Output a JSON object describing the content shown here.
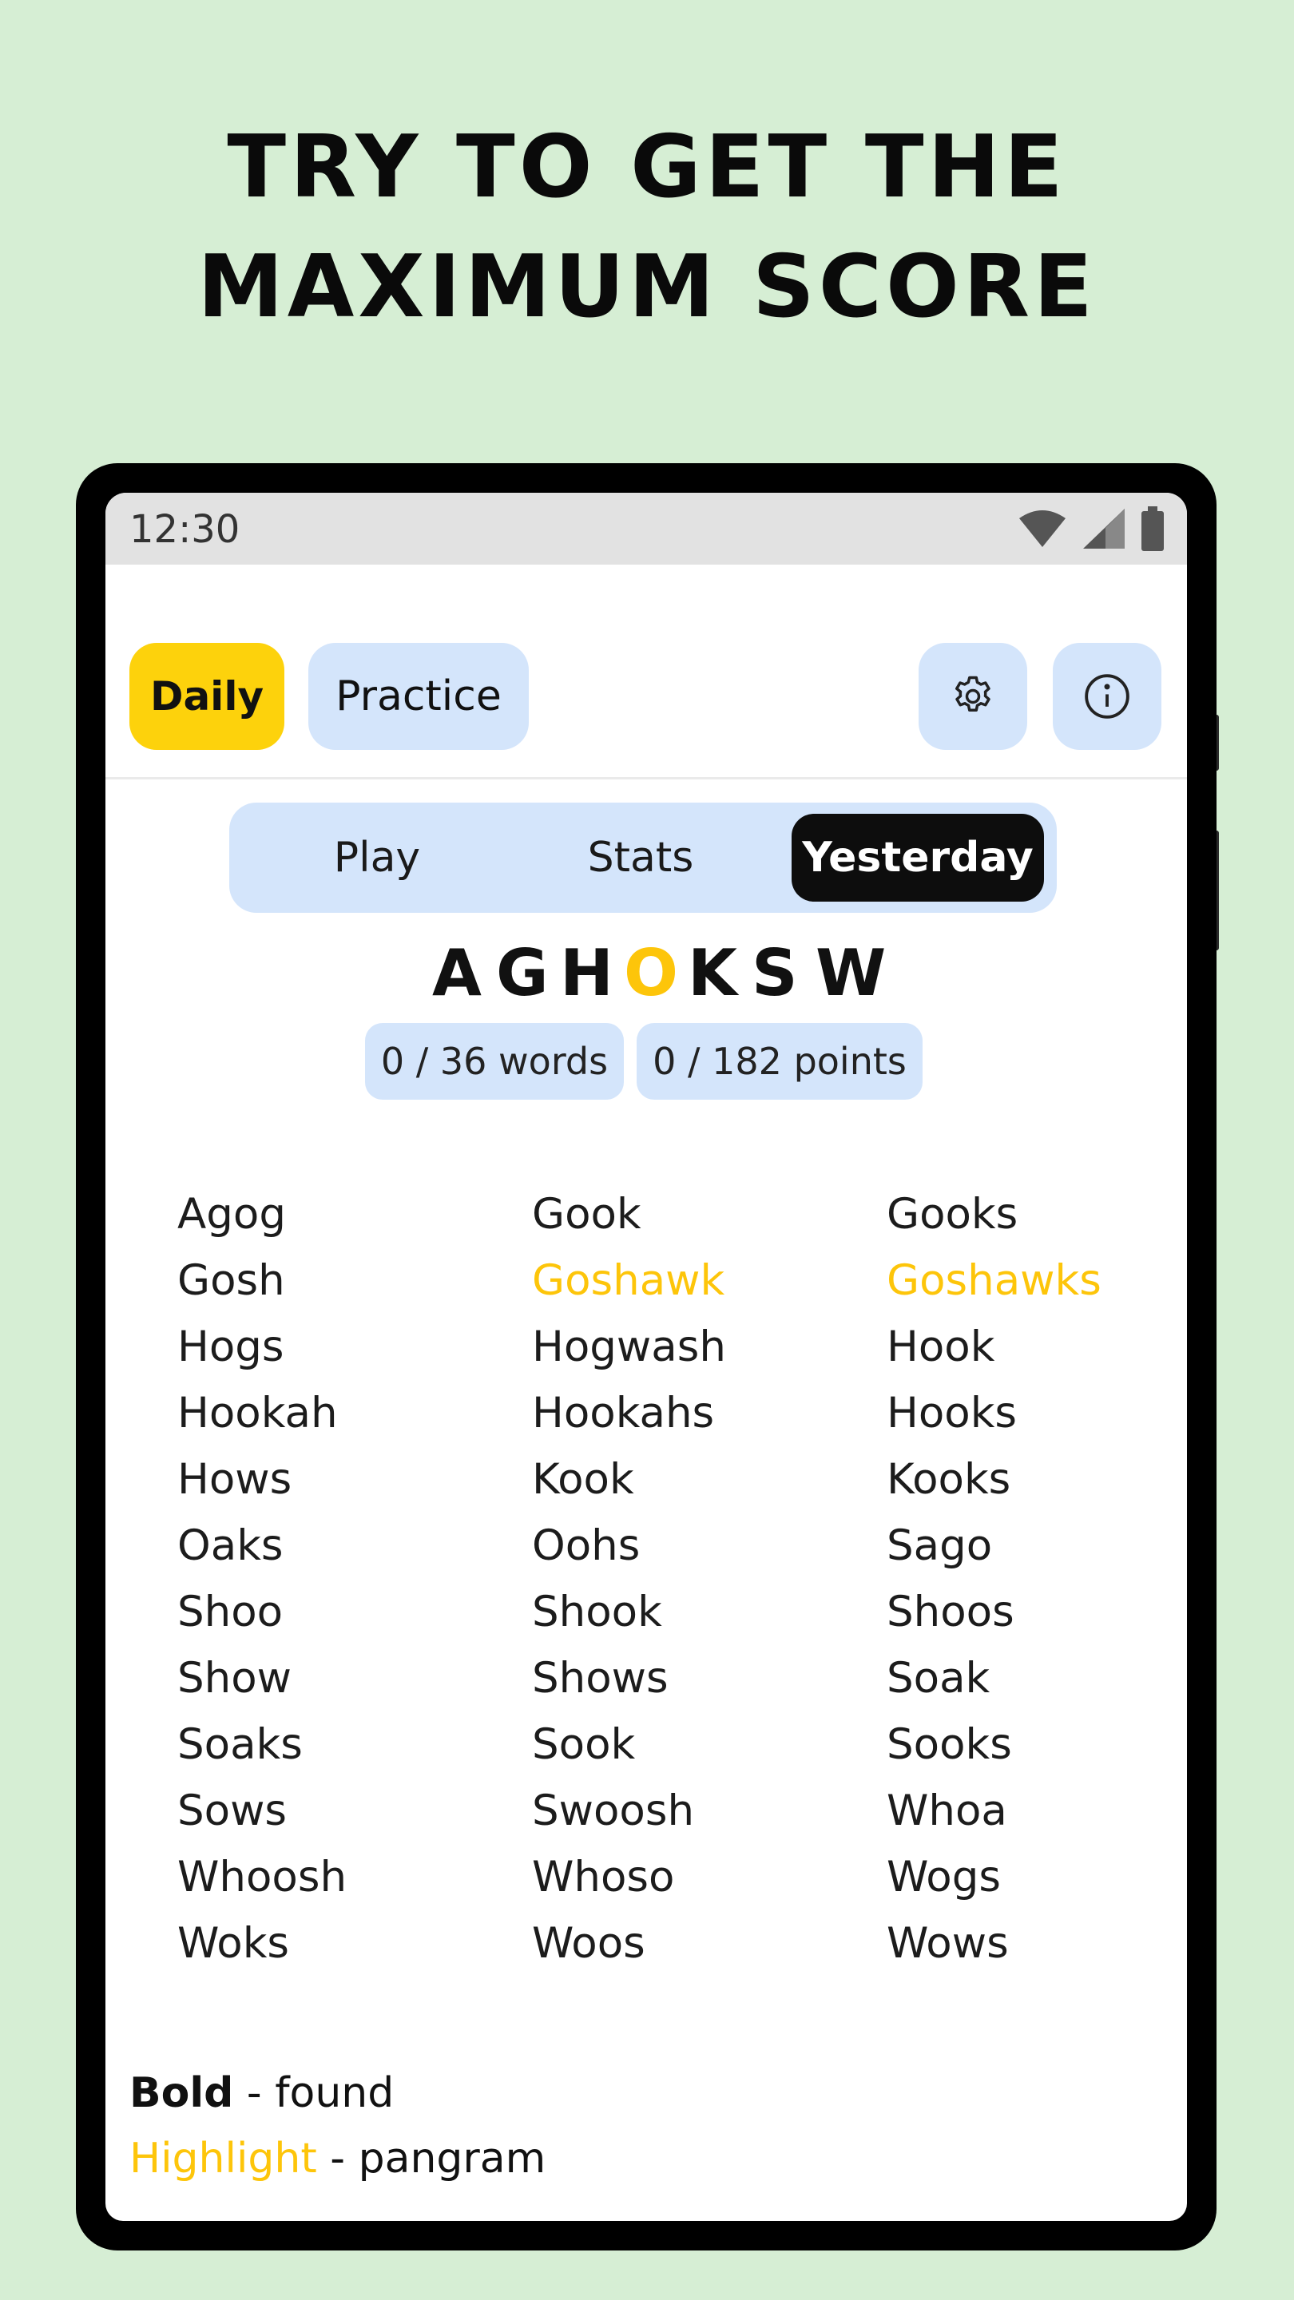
{
  "headline": {
    "line1": "TRY TO GET THE",
    "line2": "MAXIMUM SCORE"
  },
  "status_bar": {
    "time": "12:30",
    "icons": [
      "wifi-icon",
      "cell-signal-icon",
      "battery-icon"
    ]
  },
  "top_nav": {
    "daily_label": "Daily",
    "practice_label": "Practice",
    "settings_icon": "gear-icon",
    "info_icon": "info-icon"
  },
  "tabs": {
    "play": "Play",
    "stats": "Stats",
    "yesterday": "Yesterday",
    "selected": "yesterday"
  },
  "puzzle": {
    "letters": [
      "A",
      "G",
      "H",
      "O",
      "K",
      "S",
      "W"
    ],
    "center_letter": "O",
    "words_badge": "0 / 36 words",
    "points_badge": "0 / 182 points"
  },
  "word_list": [
    {
      "text": "Agog",
      "pangram": false
    },
    {
      "text": "Gook",
      "pangram": false
    },
    {
      "text": "Gooks",
      "pangram": false
    },
    {
      "text": "Gosh",
      "pangram": false
    },
    {
      "text": "Goshawk",
      "pangram": true
    },
    {
      "text": "Goshawks",
      "pangram": true
    },
    {
      "text": "Hogs",
      "pangram": false
    },
    {
      "text": "Hogwash",
      "pangram": false
    },
    {
      "text": "Hook",
      "pangram": false
    },
    {
      "text": "Hookah",
      "pangram": false
    },
    {
      "text": "Hookahs",
      "pangram": false
    },
    {
      "text": "Hooks",
      "pangram": false
    },
    {
      "text": "Hows",
      "pangram": false
    },
    {
      "text": "Kook",
      "pangram": false
    },
    {
      "text": "Kooks",
      "pangram": false
    },
    {
      "text": "Oaks",
      "pangram": false
    },
    {
      "text": "Oohs",
      "pangram": false
    },
    {
      "text": "Sago",
      "pangram": false
    },
    {
      "text": "Shoo",
      "pangram": false
    },
    {
      "text": "Shook",
      "pangram": false
    },
    {
      "text": "Shoos",
      "pangram": false
    },
    {
      "text": "Show",
      "pangram": false
    },
    {
      "text": "Shows",
      "pangram": false
    },
    {
      "text": "Soak",
      "pangram": false
    },
    {
      "text": "Soaks",
      "pangram": false
    },
    {
      "text": "Sook",
      "pangram": false
    },
    {
      "text": "Sooks",
      "pangram": false
    },
    {
      "text": "Sows",
      "pangram": false
    },
    {
      "text": "Swoosh",
      "pangram": false
    },
    {
      "text": "Whoa",
      "pangram": false
    },
    {
      "text": "Whoosh",
      "pangram": false
    },
    {
      "text": "Whoso",
      "pangram": false
    },
    {
      "text": "Wogs",
      "pangram": false
    },
    {
      "text": "Woks",
      "pangram": false
    },
    {
      "text": "Woos",
      "pangram": false
    },
    {
      "text": "Wows",
      "pangram": false
    }
  ],
  "legend": {
    "bold_term": "Bold",
    "bold_desc": " - found",
    "highlight_term": "Highlight",
    "highlight_desc": " - pangram"
  },
  "colors": {
    "background": "#d6eed4",
    "accent_yellow": "#fdd20c",
    "pangram_yellow": "#fdc50a",
    "pill_blue": "#d4e5fb",
    "selected_tab": "#0d0d0d"
  }
}
